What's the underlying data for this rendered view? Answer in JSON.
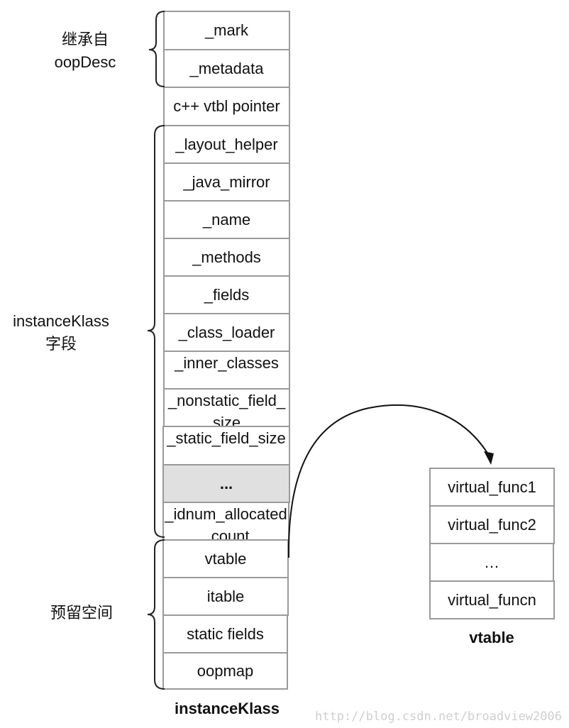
{
  "diagram": {
    "title": "instanceKlass",
    "instance_klass": {
      "caption": "instanceKlass",
      "cells": [
        {
          "text": "_mark"
        },
        {
          "text": "_metadata"
        },
        {
          "text": "c++ vtbl pointer"
        },
        {
          "text": "_layout_helper"
        },
        {
          "text": "_java_mirror"
        },
        {
          "text": "_name"
        },
        {
          "text": "_methods"
        },
        {
          "text": "_fields"
        },
        {
          "text": "_class_loader"
        },
        {
          "text": "_inner_classes"
        },
        {
          "text": "_nonstatic_field_size"
        },
        {
          "text": "_static_field_size"
        },
        {
          "text": "..."
        },
        {
          "text": "_idnum_allocated_count"
        },
        {
          "text": "vtable"
        },
        {
          "text": "itable"
        },
        {
          "text": "static fields"
        },
        {
          "text": "oopmap"
        }
      ]
    },
    "groups": [
      {
        "label_line1": "继承自",
        "label_line2": "oopDesc",
        "from": "_mark",
        "to": "_metadata"
      },
      {
        "label_line1": "instanceKlass",
        "label_line2": "字段",
        "from": "_layout_helper",
        "to": "_idnum_allocated_count"
      },
      {
        "label_line1": "预留空间",
        "label_line2": "",
        "from": "vtable",
        "to": "oopmap"
      }
    ],
    "vtable": {
      "caption": "vtable",
      "cells": [
        {
          "text": "virtual_func1"
        },
        {
          "text": "virtual_func2"
        },
        {
          "text": "…"
        },
        {
          "text": "virtual_funcn"
        }
      ]
    },
    "arrow": {
      "from": "vtable",
      "to": "virtual_func1"
    },
    "watermark": "http://blog.csdn.net/broadview2006"
  }
}
